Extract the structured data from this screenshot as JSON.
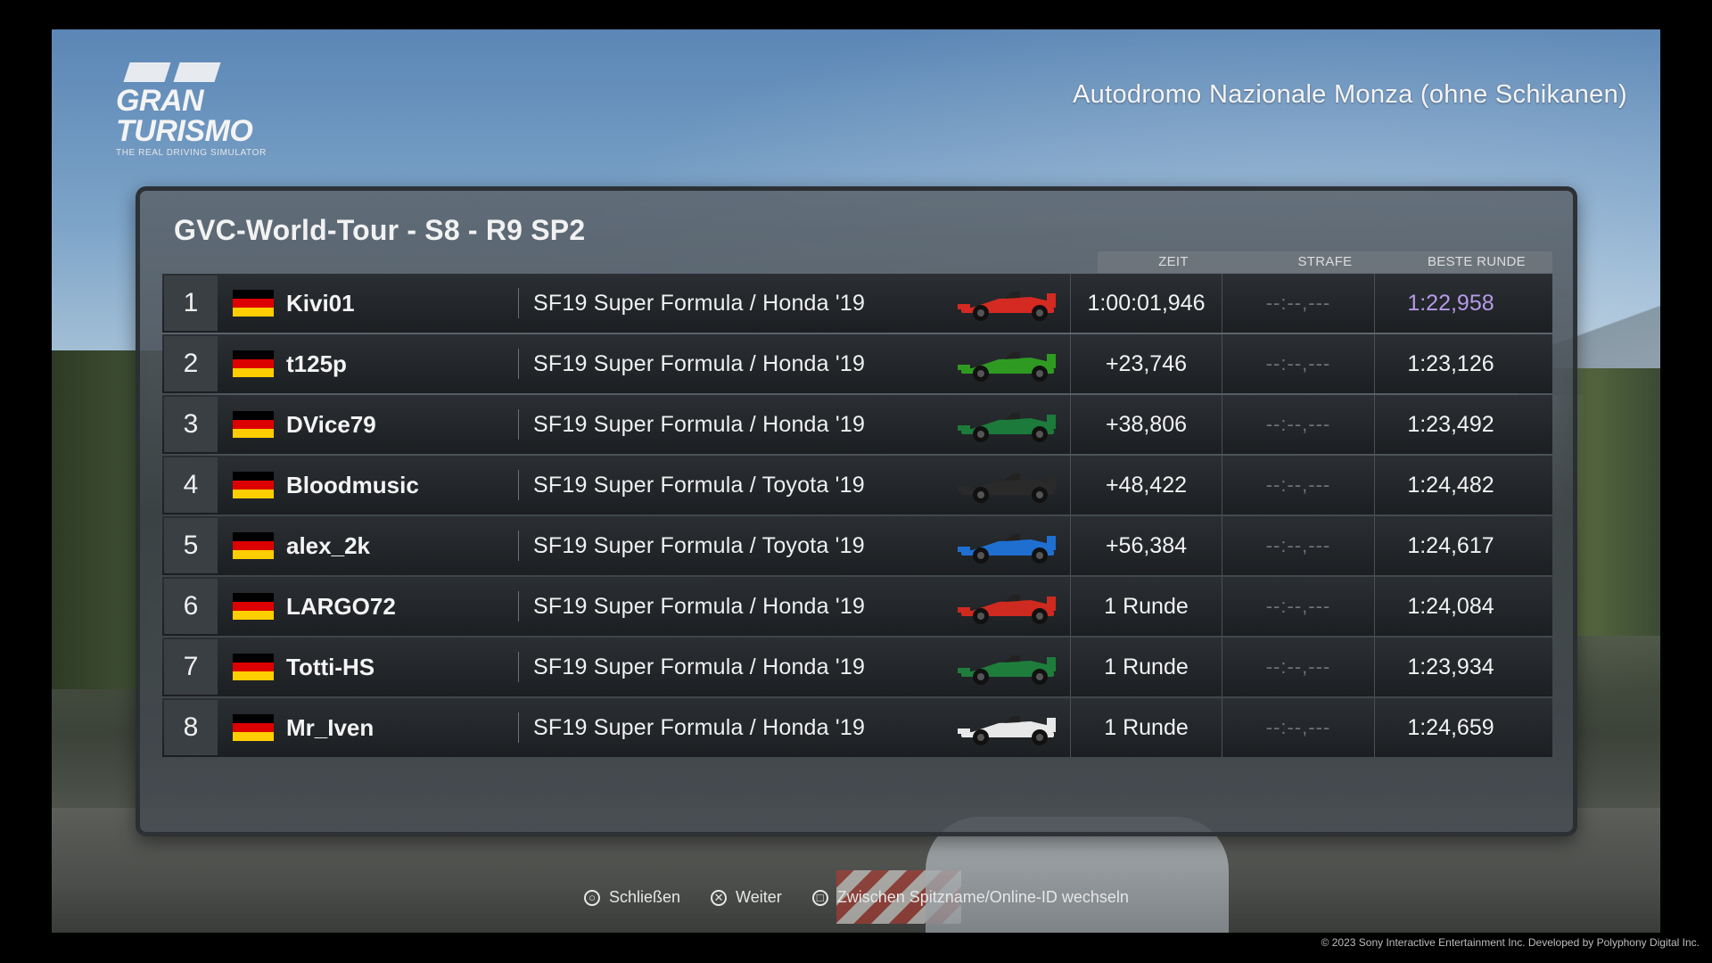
{
  "header": {
    "logo_text": "GRAN TURISMO",
    "logo_subtitle": "THE REAL DRIVING SIMULATOR",
    "track_name": "Autodromo Nazionale Monza (ohne Schikanen)"
  },
  "results": {
    "title": "GVC-World-Tour - S8 - R9 SP2",
    "columns": {
      "time": "ZEIT",
      "penalty": "STRAFE",
      "best_lap": "BESTE RUNDE"
    },
    "rows": [
      {
        "position": "1",
        "flag": "germany",
        "driver": "Kivi01",
        "car": "SF19 Super Formula / Honda '19",
        "car_color": "#d42a22",
        "time": "1:00:01,946",
        "penalty": "--:--,---",
        "best_lap": "1:22,958"
      },
      {
        "position": "2",
        "flag": "germany",
        "driver": "t125p",
        "car": "SF19 Super Formula / Honda '19",
        "car_color": "#2f9a22",
        "time": "+23,746",
        "penalty": "--:--,---",
        "best_lap": "1:23,126"
      },
      {
        "position": "3",
        "flag": "germany",
        "driver": "DVice79",
        "car": "SF19 Super Formula / Honda '19",
        "car_color": "#1c7a3a",
        "time": "+38,806",
        "penalty": "--:--,---",
        "best_lap": "1:23,492"
      },
      {
        "position": "4",
        "flag": "germany",
        "driver": "Bloodmusic",
        "car": "SF19 Super Formula / Toyota '19",
        "car_color": "#2a2a2a",
        "time": "+48,422",
        "penalty": "--:--,---",
        "best_lap": "1:24,482"
      },
      {
        "position": "5",
        "flag": "germany",
        "driver": "alex_2k",
        "car": "SF19 Super Formula / Toyota '19",
        "car_color": "#1f6fd1",
        "time": "+56,384",
        "penalty": "--:--,---",
        "best_lap": "1:24,617"
      },
      {
        "position": "6",
        "flag": "germany",
        "driver": "LARGO72",
        "car": "SF19 Super Formula / Honda '19",
        "car_color": "#cf2a20",
        "time": "1 Runde",
        "penalty": "--:--,---",
        "best_lap": "1:24,084"
      },
      {
        "position": "7",
        "flag": "germany",
        "driver": "Totti-HS",
        "car": "SF19 Super Formula / Honda '19",
        "car_color": "#1f7d3c",
        "time": "1 Runde",
        "penalty": "--:--,---",
        "best_lap": "1:23,934"
      },
      {
        "position": "8",
        "flag": "germany",
        "driver": "Mr_Iven",
        "car": "SF19 Super Formula / Honda '19",
        "car_color": "#e8e8e8",
        "time": "1 Runde",
        "penalty": "--:--,---",
        "best_lap": "1:24,659"
      }
    ],
    "fastest_lap_color": "#b59ae8"
  },
  "controls": [
    {
      "icon": "circle-button-icon",
      "label": "Schließen"
    },
    {
      "icon": "cross-button-icon",
      "label": "Weiter"
    },
    {
      "icon": "square-button-icon",
      "label": "Zwischen Spitzname/Online-ID wechseln"
    }
  ],
  "footer": {
    "copyright": "© 2023 Sony Interactive Entertainment Inc. Developed by Polyphony Digital Inc."
  }
}
